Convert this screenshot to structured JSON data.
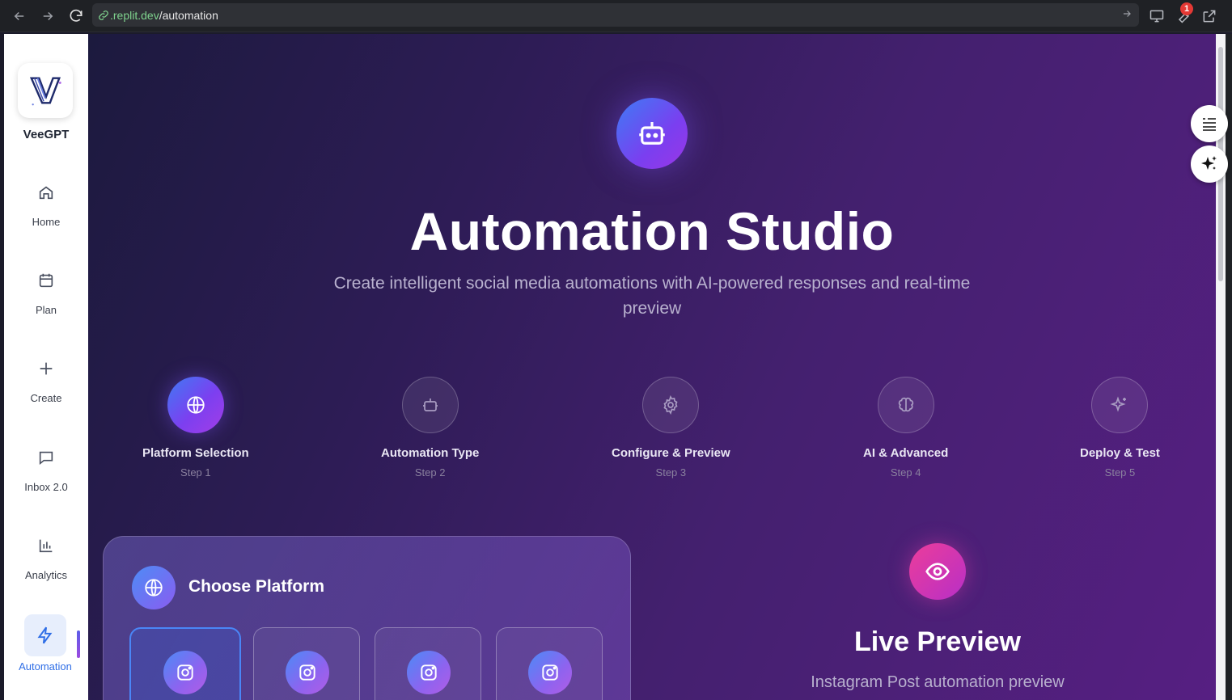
{
  "browser": {
    "url_domain": ".replit.dev",
    "url_path": "/automation",
    "notification_count": "1"
  },
  "sidebar": {
    "brand": "VeeGPT",
    "items": [
      {
        "label": "Home",
        "icon": "home-icon"
      },
      {
        "label": "Plan",
        "icon": "calendar-icon"
      },
      {
        "label": "Create",
        "icon": "plus-icon"
      },
      {
        "label": "Inbox 2.0",
        "icon": "message-icon"
      },
      {
        "label": "Analytics",
        "icon": "bar-chart-icon"
      },
      {
        "label": "Automation",
        "icon": "lightning-icon",
        "active": true
      }
    ]
  },
  "hero": {
    "title": "Automation Studio",
    "subtitle": "Create intelligent social media automations with AI-powered responses and real-time preview"
  },
  "steps": [
    {
      "title": "Platform Selection",
      "sub": "Step 1",
      "icon": "globe-icon",
      "active": true
    },
    {
      "title": "Automation Type",
      "sub": "Step 2",
      "icon": "robot-icon"
    },
    {
      "title": "Configure & Preview",
      "sub": "Step 3",
      "icon": "gear-icon"
    },
    {
      "title": "AI & Advanced",
      "sub": "Step 4",
      "icon": "brain-icon"
    },
    {
      "title": "Deploy & Test",
      "sub": "Step 5",
      "icon": "sparkle-icon"
    }
  ],
  "platform_card": {
    "title": "Choose Platform",
    "tiles": [
      "instagram-icon",
      "instagram-icon",
      "instagram-icon",
      "instagram-icon"
    ]
  },
  "preview": {
    "title": "Live Preview",
    "subtitle": "Instagram Post automation preview"
  },
  "colors": {
    "accent_blue": "#3d7cf5",
    "accent_purple": "#7a3ff0",
    "accent_pink": "#ec3d9a",
    "sidebar_active": "#2f6ee6"
  }
}
